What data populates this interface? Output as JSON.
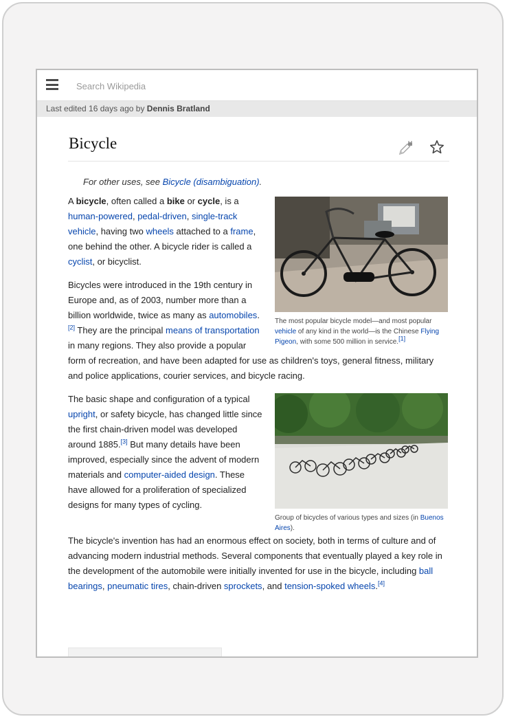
{
  "search": {
    "placeholder": "Search Wikipedia"
  },
  "last_edited": {
    "prefix": "Last edited 16 days ago by ",
    "user": "Dennis Bratland"
  },
  "article": {
    "title": "Bicycle",
    "hatnote": {
      "prefix": "For other uses, see ",
      "link": "Bicycle (disambiguation)",
      "suffix": "."
    },
    "p1": {
      "t1": "A ",
      "b1": "bicycle",
      "t2": ", often called a ",
      "b2": "bike",
      "t3": " or ",
      "b3": "cycle",
      "t4": ", is a ",
      "l1": "human-powered",
      "t5": ", ",
      "l2": "pedal-driven",
      "t6": ", ",
      "l3": "single-track vehicle",
      "t7": ", having two ",
      "l4": "wheels",
      "t8": " attached to a ",
      "l5": "frame",
      "t9": ", one behind the other. A bicycle rider is called a ",
      "l6": "cyclist",
      "t10": ", or bicyclist."
    },
    "p2": {
      "t1": "Bicycles were introduced in the 19th century in Europe and, as of 2003, number more than a billion worldwide, twice as many as ",
      "l1": "automobiles",
      "t2": ".",
      "r1": "[2]",
      "t3": " They are the principal ",
      "l2": "means of transportation",
      "t4": " in many regions. They also provide a popular form of recreation, and have been adapted for use as children's toys, general fitness, military and police applications, courier services, and bicycle racing."
    },
    "p3": {
      "t1": "The basic shape and configuration of a typical ",
      "l1": "upright",
      "t2": ", or safety bicycle, has changed little since the first chain-driven model was developed around 1885.",
      "r1": "[3]",
      "t3": " But many details have been improved, especially since the advent of modern materials and ",
      "l2": "computer-aided design",
      "t4": ". These have allowed for a proliferation of specialized designs for many types of cycling."
    },
    "p4": {
      "t1": "The bicycle's invention has had an enormous effect on society, both in terms of culture and of advancing modern industrial methods. Several components that eventually played a key role in the development of the automobile were initially invented for use in the bicycle, including ",
      "l1": "ball bearings",
      "t2": ", ",
      "l2": "pneumatic tires",
      "t3": ", chain-driven ",
      "l3": "sprockets",
      "t4": ", and ",
      "l4": "tension-spoked wheels",
      "t5": ".",
      "r1": "[4]"
    },
    "figure1": {
      "c1": "The most popular bicycle model—and most popular ",
      "l1": "vehicle",
      "c2": " of any kind in the world—is the Chinese ",
      "l2": "Flying Pigeon",
      "c3": ", with some 500 million in service.",
      "r1": "[1]"
    },
    "figure2": {
      "c1": "Group of bicycles of various types and sizes (in ",
      "l1": "Buenos Aires",
      "c2": ")."
    }
  },
  "icons": {
    "menu": "hamburger-icon",
    "edit": "pencil-lock-icon",
    "watch": "star-icon"
  },
  "colors": {
    "link": "#0645ad",
    "bar": "#e8e8e8",
    "frame": "#f4f3f3"
  }
}
